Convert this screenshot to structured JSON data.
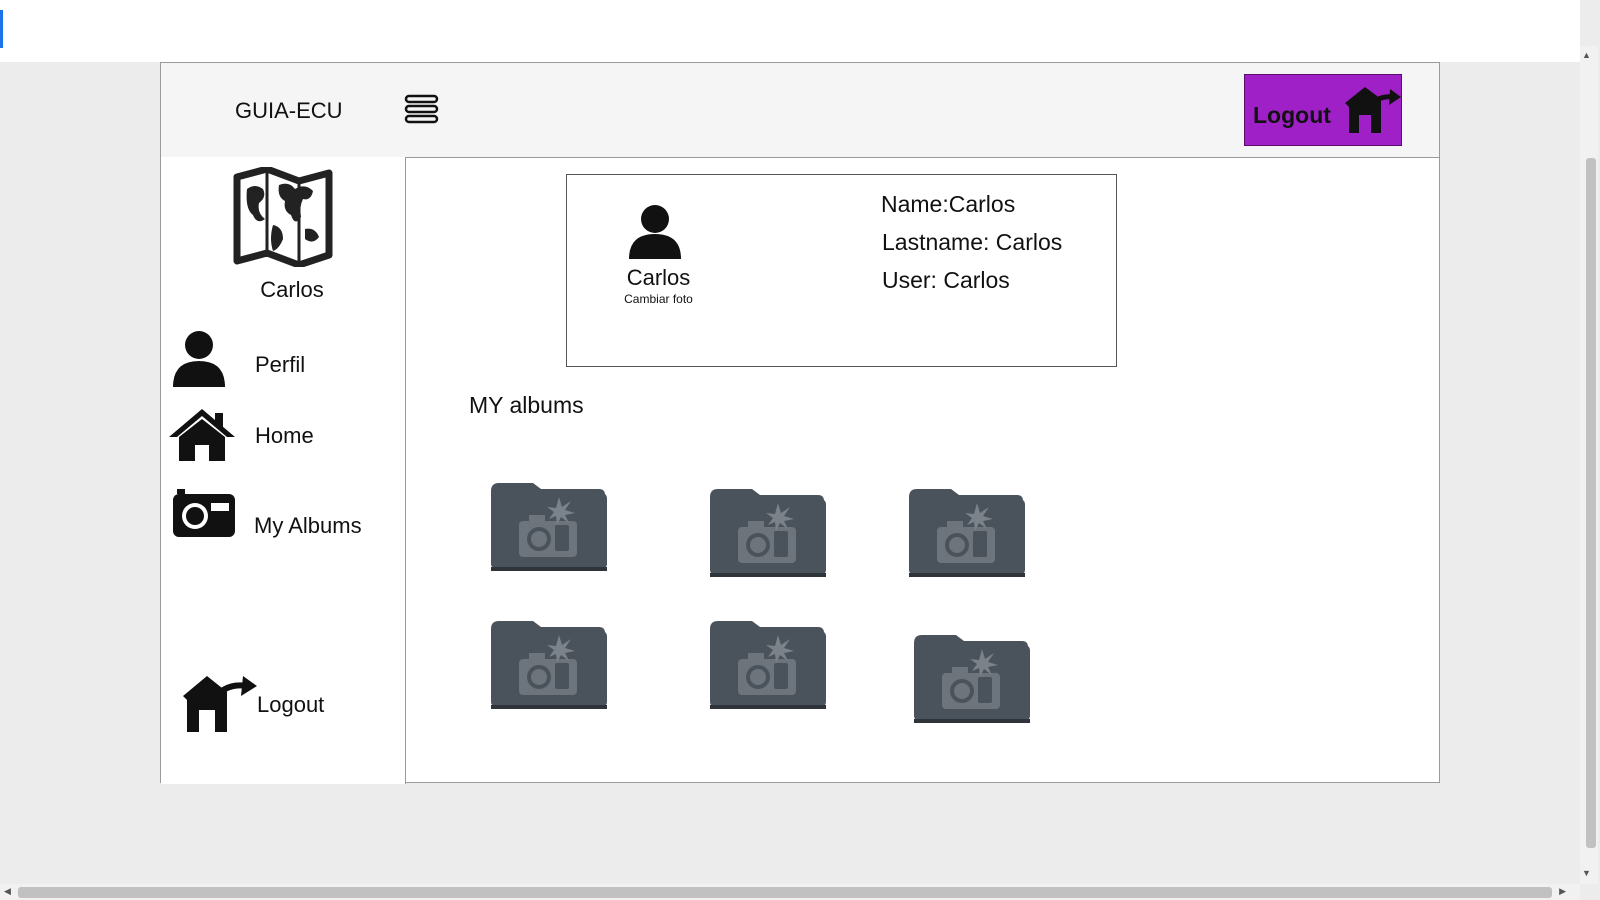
{
  "app": {
    "brand": "GUIA-ECU"
  },
  "header": {
    "logout_label": "Logout"
  },
  "sidebar": {
    "username": "Carlos",
    "items": [
      {
        "label": "Perfil",
        "icon": "user-icon"
      },
      {
        "label": "Home",
        "icon": "home-icon"
      },
      {
        "label": "My Albums",
        "icon": "camera-icon"
      },
      {
        "label": "Logout",
        "icon": "logout-icon"
      }
    ]
  },
  "profile": {
    "display_name": "Carlos",
    "change_photo": "Cambiar foto",
    "name_line": "Name:Carlos",
    "lastname_line": "Lastname: Carlos",
    "user_line": "User: Carlos"
  },
  "albums": {
    "title": "MY albums",
    "count": 6,
    "icon": "photo-folder-icon"
  },
  "colors": {
    "logout_button": "#a020c8",
    "folder": "#4a525b",
    "page_bg": "#ececec"
  }
}
